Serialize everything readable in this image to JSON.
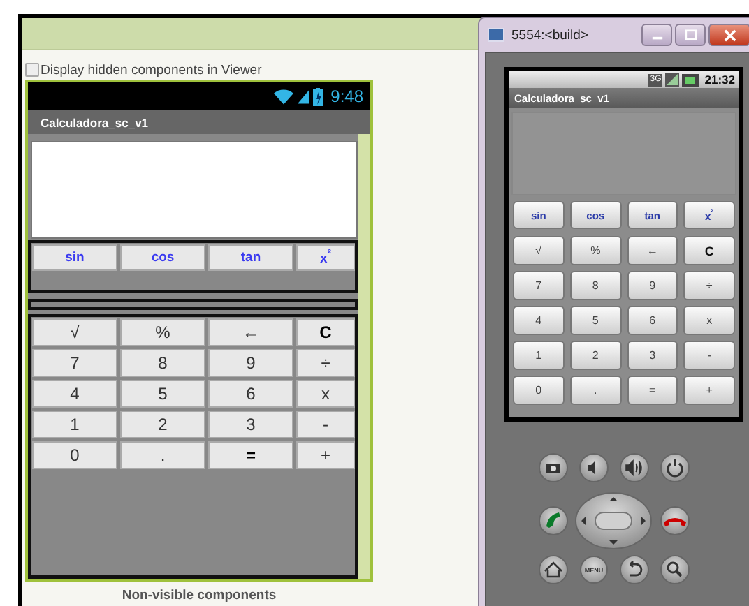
{
  "designer": {
    "hidden_toggle": {
      "label": "Display hidden components in Viewer",
      "checked": false
    },
    "phone": {
      "time": "9:48",
      "app_title": "Calculadora_sc_v1",
      "function_keys": [
        "sin",
        "cos",
        "tan",
        "x$^{²}$"
      ],
      "keypad": [
        [
          {
            "label": "√",
            "bold": false
          },
          {
            "label": "%",
            "bold": false
          },
          {
            "label": "←",
            "bold": false
          },
          {
            "label": "C",
            "bold": true
          }
        ],
        [
          {
            "label": "7",
            "bold": false
          },
          {
            "label": "8",
            "bold": false
          },
          {
            "label": "9",
            "bold": false
          },
          {
            "label": "÷",
            "bold": false
          }
        ],
        [
          {
            "label": "4",
            "bold": false
          },
          {
            "label": "5",
            "bold": false
          },
          {
            "label": "6",
            "bold": false
          },
          {
            "label": "x",
            "bold": false
          }
        ],
        [
          {
            "label": "1",
            "bold": false
          },
          {
            "label": "2",
            "bold": false
          },
          {
            "label": "3",
            "bold": false
          },
          {
            "label": "-",
            "bold": false
          }
        ],
        [
          {
            "label": "0",
            "bold": false
          },
          {
            "label": ".",
            "bold": false
          },
          {
            "label": "=",
            "bold": true
          },
          {
            "label": "+",
            "bold": false
          }
        ]
      ]
    },
    "footer": "Non-visible components"
  },
  "emulator": {
    "title": "5554:<build>",
    "time": "21:32",
    "network": "3G",
    "app_title": "Calculadora_sc_v1",
    "function_keys": [
      "sin",
      "cos",
      "tan",
      "x$^{²}$"
    ],
    "keypad": [
      [
        {
          "label": "√",
          "bold": false
        },
        {
          "label": "%",
          "bold": false
        },
        {
          "label": "←",
          "bold": false
        },
        {
          "label": "C",
          "bold": true
        }
      ],
      [
        {
          "label": "7",
          "bold": false
        },
        {
          "label": "8",
          "bold": false
        },
        {
          "label": "9",
          "bold": false
        },
        {
          "label": "÷",
          "bold": false
        }
      ],
      [
        {
          "label": "4",
          "bold": false
        },
        {
          "label": "5",
          "bold": false
        },
        {
          "label": "6",
          "bold": false
        },
        {
          "label": "x",
          "bold": false
        }
      ],
      [
        {
          "label": "1",
          "bold": false
        },
        {
          "label": "2",
          "bold": false
        },
        {
          "label": "3",
          "bold": false
        },
        {
          "label": "-",
          "bold": false
        }
      ],
      [
        {
          "label": "0",
          "bold": false
        },
        {
          "label": ".",
          "bold": false
        },
        {
          "label": "=",
          "bold": false
        },
        {
          "label": "+",
          "bold": false
        }
      ]
    ],
    "menu_key": "MENU"
  }
}
